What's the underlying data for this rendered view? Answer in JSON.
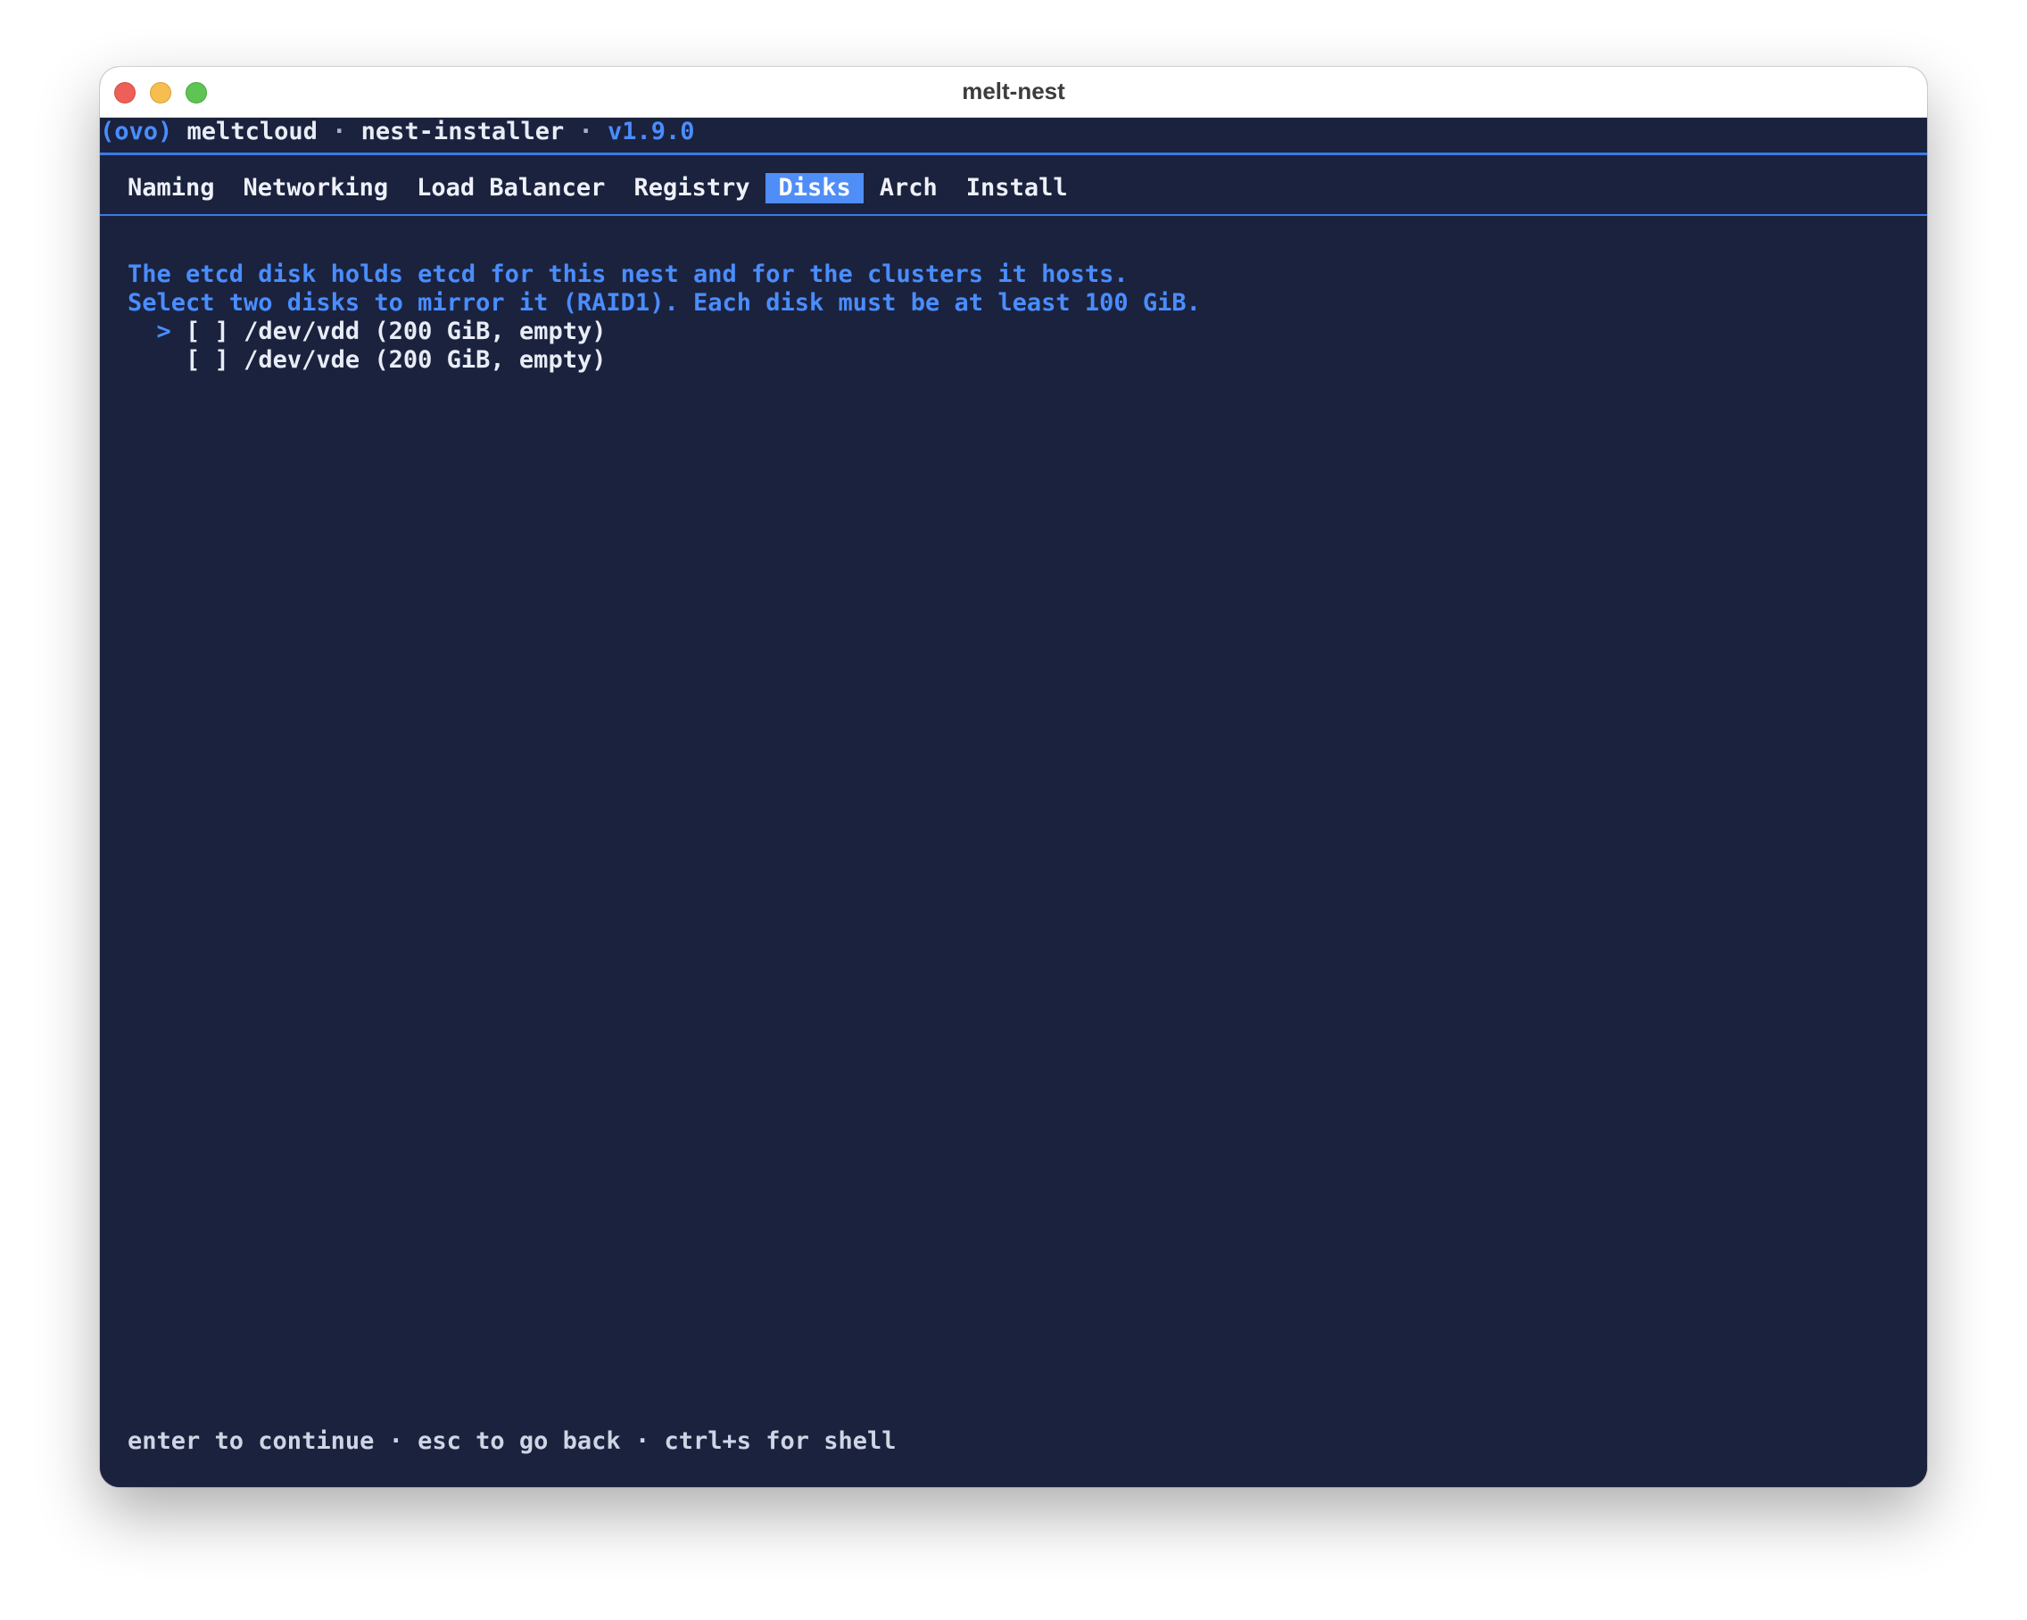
{
  "window": {
    "title": "melt-nest"
  },
  "header": {
    "logo": "(ovo)",
    "product": "meltcloud",
    "sep1": "·",
    "app": "nest-installer",
    "sep2": "·",
    "version": "v1.9.0"
  },
  "tabs": [
    {
      "label": "Naming",
      "active": false
    },
    {
      "label": "Networking",
      "active": false
    },
    {
      "label": "Load Balancer",
      "active": false
    },
    {
      "label": "Registry",
      "active": false
    },
    {
      "label": "Disks",
      "active": true
    },
    {
      "label": "Arch",
      "active": false
    },
    {
      "label": "Install",
      "active": false
    }
  ],
  "content": {
    "info_line1": "The etcd disk holds etcd for this nest and for the clusters it hosts.",
    "info_line2": "Select two disks to mirror it (RAID1). Each disk must be at least 100 GiB.",
    "cursor": ">",
    "options": [
      {
        "checkbox": "[ ]",
        "label": "/dev/vdd (200 GiB, empty)",
        "focused": true
      },
      {
        "checkbox": "[ ]",
        "label": "/dev/vde (200 GiB, empty)",
        "focused": false
      }
    ]
  },
  "footer": {
    "hint": "enter to continue · esc to go back · ctrl+s for shell"
  },
  "colors": {
    "background": "#1b223e",
    "accent": "#4a8dff",
    "active_tab": "#4f8ef7",
    "rule": "#3b7ae8",
    "text": "#e8ecf5"
  }
}
